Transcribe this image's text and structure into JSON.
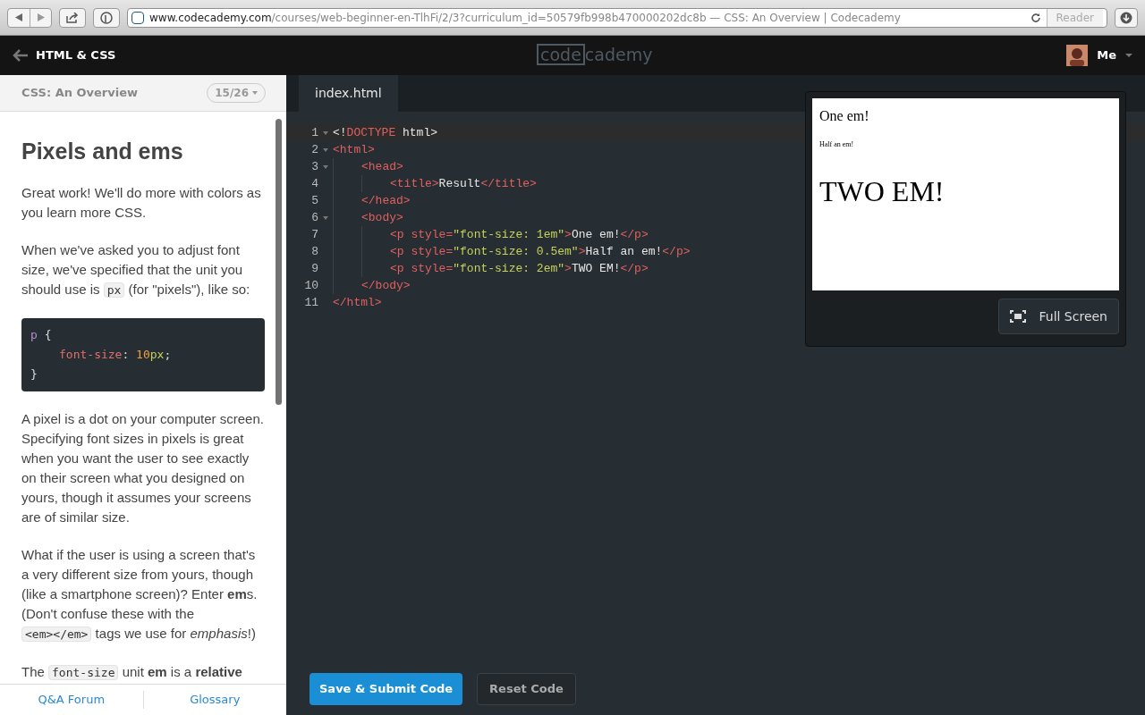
{
  "browser": {
    "url_domain": "www.codecademy.com",
    "url_rest": "/courses/web-beginner-en-TlhFi/2/3?curriculum_id=50579fb998b470000202dc8b — CSS: An Overview | Codecademy",
    "reader": "Reader"
  },
  "header": {
    "back_label": "HTML & CSS",
    "logo_left": "code",
    "logo_right": "cademy",
    "user": "Me"
  },
  "lesson": {
    "section": "CSS: An Overview",
    "progress": "15/26",
    "title": "Pixels and ems",
    "paragraphs": [
      [
        {
          "kind": "text",
          "text": "Great work! We'll do more with colors as you learn more CSS."
        }
      ],
      [
        {
          "kind": "text",
          "text": "When we've asked you to adjust font size, we've specified that the unit you should use is "
        },
        {
          "kind": "code",
          "text": "px"
        },
        {
          "kind": "text",
          "text": " (for \"pixels\"), like so:"
        }
      ],
      [
        {
          "kind": "block",
          "lines": [
            [
              {
                "kind": "sel",
                "text": "p"
              },
              {
                "kind": "plain",
                "text": " {"
              }
            ],
            [
              {
                "kind": "indent"
              },
              {
                "kind": "prop",
                "text": "font-size"
              },
              {
                "kind": "plain",
                "text": ": "
              },
              {
                "kind": "num",
                "text": "10"
              },
              {
                "kind": "unit",
                "text": "px"
              },
              {
                "kind": "plain",
                "text": ";"
              }
            ],
            [
              {
                "kind": "plain",
                "text": "}"
              }
            ]
          ]
        }
      ],
      [
        {
          "kind": "text",
          "text": "A pixel is a dot on your computer screen. Specifying font sizes in pixels is great when you want the user to see exactly on their screen what you designed on yours, though it assumes your screens are of similar size."
        }
      ],
      [
        {
          "kind": "text",
          "text": "What if the user is using a screen that's a very different size from yours, though (like a smartphone screen)? Enter **em**s. (Don't confuse these with the "
        },
        {
          "kind": "code",
          "text": "<em></em>"
        },
        {
          "kind": "text",
          "text": " tags we use for *emphasis*!)"
        }
      ],
      [
        {
          "kind": "text",
          "text": "The "
        },
        {
          "kind": "code",
          "text": "font-size"
        },
        {
          "kind": "text",
          "text": " unit **em** is a **relative**"
        }
      ]
    ],
    "footer_links": [
      "Q&A Forum",
      "Glossary"
    ]
  },
  "editor": {
    "tabs": [
      {
        "label": "index.html",
        "selected": true
      }
    ],
    "lines": [
      {
        "number": "1",
        "foldable": true,
        "tokens": [
          {
            "kind": "plain",
            "text": "<!"
          },
          {
            "kind": "tag",
            "text": "DOCTYPE"
          },
          {
            "kind": "plain",
            "text": " html>"
          }
        ]
      },
      {
        "number": "2",
        "foldable": true,
        "tokens": [
          {
            "kind": "tag",
            "text": "<html>"
          }
        ]
      },
      {
        "number": "3",
        "foldable": true,
        "tokens": [
          {
            "kind": "indent"
          },
          {
            "kind": "tag",
            "text": "<head>"
          }
        ]
      },
      {
        "number": "4",
        "foldable": false,
        "tokens": [
          {
            "kind": "indent"
          },
          {
            "kind": "indent"
          },
          {
            "kind": "tag",
            "text": "<title>"
          },
          {
            "kind": "plain",
            "text": "Result"
          },
          {
            "kind": "tag",
            "text": "</title>"
          }
        ]
      },
      {
        "number": "5",
        "foldable": false,
        "tokens": [
          {
            "kind": "indent"
          },
          {
            "kind": "tag",
            "text": "</head>"
          }
        ]
      },
      {
        "number": "6",
        "foldable": true,
        "tokens": [
          {
            "kind": "indent"
          },
          {
            "kind": "tag",
            "text": "<body>"
          }
        ]
      },
      {
        "number": "7",
        "foldable": false,
        "tokens": [
          {
            "kind": "indent"
          },
          {
            "kind": "indent"
          },
          {
            "kind": "tag",
            "text": "<p "
          },
          {
            "kind": "attr",
            "text": "style"
          },
          {
            "kind": "tag",
            "text": "="
          },
          {
            "kind": "string",
            "text": "\"font-size: 1em\""
          },
          {
            "kind": "tag",
            "text": ">"
          },
          {
            "kind": "plain",
            "text": "One em!"
          },
          {
            "kind": "tag",
            "text": "</p>"
          }
        ]
      },
      {
        "number": "8",
        "foldable": false,
        "tokens": [
          {
            "kind": "indent"
          },
          {
            "kind": "indent"
          },
          {
            "kind": "tag",
            "text": "<p "
          },
          {
            "kind": "attr",
            "text": "style"
          },
          {
            "kind": "tag",
            "text": "="
          },
          {
            "kind": "string",
            "text": "\"font-size: 0.5em\""
          },
          {
            "kind": "tag",
            "text": ">"
          },
          {
            "kind": "plain",
            "text": "Half an em!"
          },
          {
            "kind": "tag",
            "text": "</p>"
          }
        ]
      },
      {
        "number": "9",
        "foldable": false,
        "tokens": [
          {
            "kind": "indent"
          },
          {
            "kind": "indent"
          },
          {
            "kind": "tag",
            "text": "<p "
          },
          {
            "kind": "attr",
            "text": "style"
          },
          {
            "kind": "tag",
            "text": "="
          },
          {
            "kind": "string",
            "text": "\"font-size: 2em\""
          },
          {
            "kind": "tag",
            "text": ">"
          },
          {
            "kind": "plain",
            "text": "TWO EM!"
          },
          {
            "kind": "tag",
            "text": "</p>"
          }
        ]
      },
      {
        "number": "10",
        "foldable": false,
        "tokens": [
          {
            "kind": "indent"
          },
          {
            "kind": "tag",
            "text": "</body>"
          }
        ]
      },
      {
        "number": "11",
        "foldable": false,
        "tokens": [
          {
            "kind": "tag",
            "text": "</html>"
          }
        ]
      }
    ],
    "buttons": [
      {
        "label": "Save & Submit Code",
        "kind": "primary"
      },
      {
        "label": "Reset Code",
        "kind": "secondary"
      }
    ]
  },
  "preview": {
    "paragraphs": [
      {
        "text": "One em!",
        "kind": "normal"
      },
      {
        "text": "Half an em!",
        "kind": "half"
      },
      {
        "text": "TWO EM!",
        "kind": "double"
      }
    ],
    "fullscreen": "Full Screen"
  }
}
